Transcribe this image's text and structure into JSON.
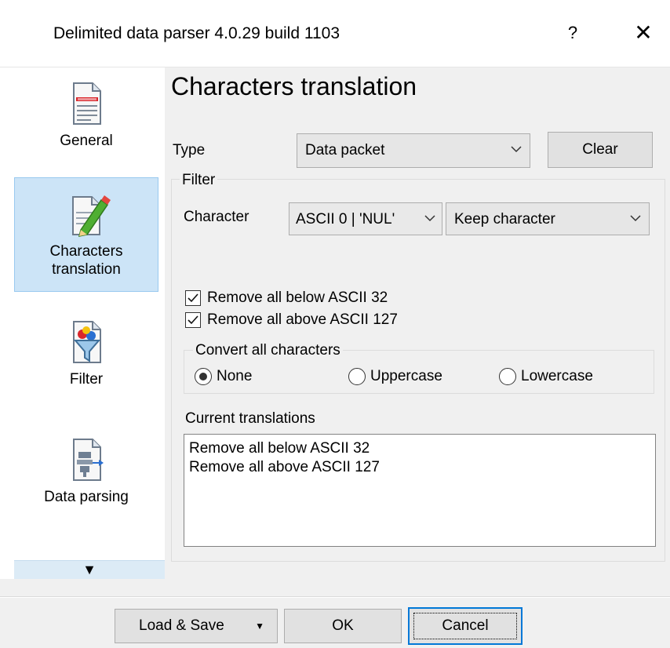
{
  "window": {
    "title": "Delimited data parser 4.0.29 build 1103",
    "help_label": "?",
    "close_label": "✕"
  },
  "nav": {
    "items": [
      {
        "label": "General",
        "icon": "document-icon"
      },
      {
        "label": "Characters\ntranslation",
        "icon": "edit-document-icon",
        "active": true
      },
      {
        "label": "Filter",
        "icon": "funnel-icon"
      },
      {
        "label": "Data parsing",
        "icon": "parser-gear-icon"
      }
    ],
    "scroll_label": "▼"
  },
  "page": {
    "title": "Characters translation"
  },
  "type_row": {
    "label": "Type",
    "value": "Data packet",
    "clear_label": "Clear"
  },
  "filter": {
    "title": "Filter",
    "character_label": "Character",
    "character_value": "ASCII 0 | 'NUL'",
    "action_value": "Keep character",
    "remove_below": {
      "label": "Remove all below ASCII 32",
      "checked": true
    },
    "remove_above": {
      "label": "Remove all above ASCII 127",
      "checked": true
    },
    "convert": {
      "title": "Convert all characters",
      "options": [
        "None",
        "Uppercase",
        "Lowercase"
      ],
      "selected": "None"
    },
    "current_label": "Current translations",
    "current_list": [
      "Remove all below ASCII 32",
      "Remove all above ASCII 127"
    ]
  },
  "footer": {
    "load_save_label": "Load & Save",
    "load_save_arrow": "▼",
    "ok_label": "OK",
    "cancel_label": "Cancel"
  },
  "colors": {
    "accent": "#0078d7",
    "nav_active_bg": "#cce4f7",
    "nav_active_border": "#99c9ef"
  }
}
